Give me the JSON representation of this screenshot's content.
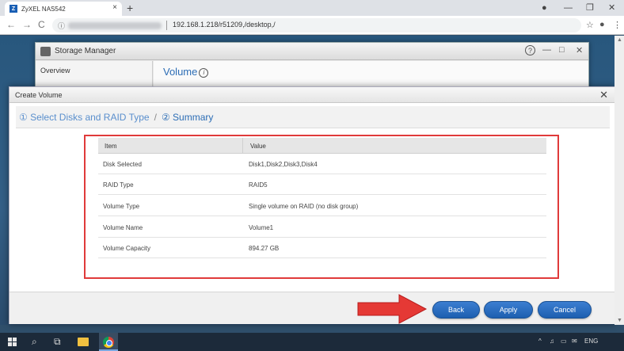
{
  "browser": {
    "tab_title": "ZyXEL NAS542",
    "favicon_letter": "Z",
    "tab_close": "×",
    "new_tab": "+",
    "url": "192.168.1.218/r51209,/desktop,/",
    "back": "←",
    "forward": "→",
    "reload": "C",
    "lock": "ⓘ",
    "star": "☆",
    "account": "●",
    "menu": "⋮",
    "record": "●",
    "minimize": "—",
    "restore": "❐",
    "close": "✕"
  },
  "storage_manager": {
    "title": "Storage Manager",
    "sidebar_item": "Overview",
    "section_title": "Volume",
    "info": "i",
    "help": "?",
    "minimize": "—",
    "maximize": "□",
    "close": "✕"
  },
  "dialog": {
    "title": "Create Volume",
    "close": "✕",
    "steps": {
      "step1": "① Select Disks and RAID Type",
      "separator": "/",
      "step2": "② Summary"
    },
    "table": {
      "headers": [
        "Item",
        "Value"
      ],
      "rows": [
        {
          "item": "Disk Selected",
          "value": "Disk1,Disk2,Disk3,Disk4"
        },
        {
          "item": "RAID Type",
          "value": "RAID5"
        },
        {
          "item": "Volume Type",
          "value": "Single volume on RAID (no disk group)"
        },
        {
          "item": "Volume Name",
          "value": "Volume1"
        },
        {
          "item": "Volume Capacity",
          "value": "894.27 GB"
        }
      ]
    },
    "buttons": {
      "back": "Back",
      "apply": "Apply",
      "cancel": "Cancel"
    }
  },
  "taskbar": {
    "search": "⌕",
    "task_view": "⧉",
    "language": "ENG",
    "tray_icons": [
      "^",
      "♫",
      "▭",
      "✉"
    ]
  },
  "colors": {
    "accent_blue": "#2c6db5",
    "highlight_red": "#e03a3a",
    "button_blue": "#1d5fb0"
  }
}
